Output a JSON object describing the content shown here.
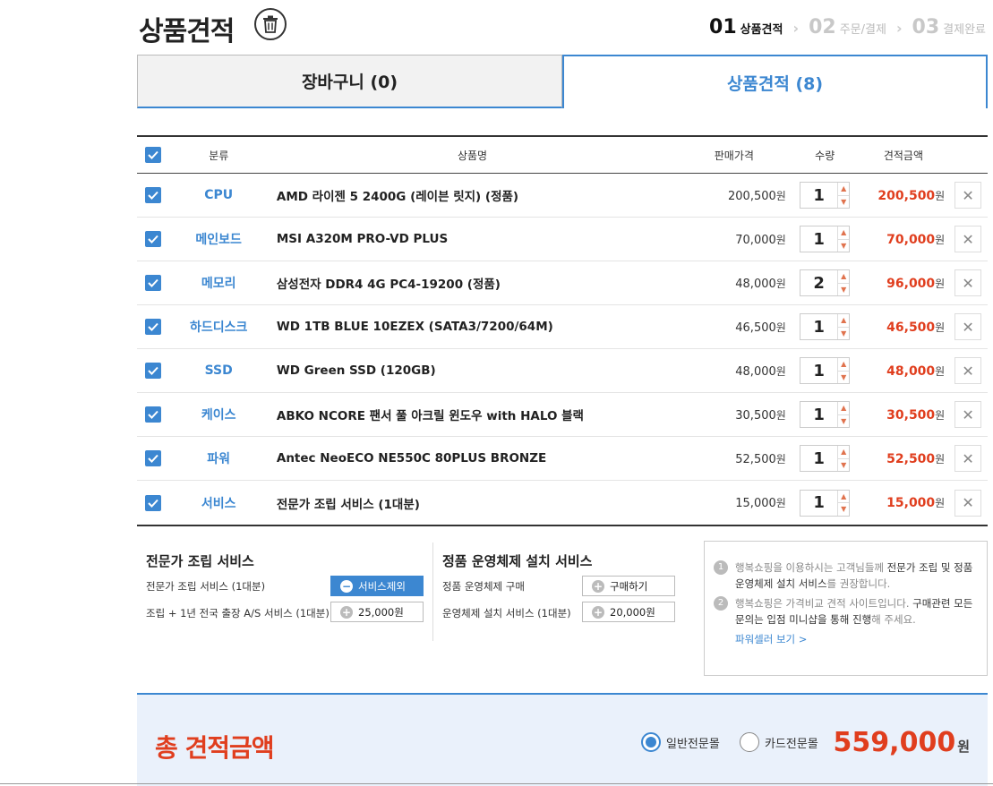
{
  "header": {
    "title": "상품견적",
    "trash_icon": "trash-icon"
  },
  "steps": [
    {
      "num": "01",
      "label": "상품견적",
      "active": true
    },
    {
      "num": "02",
      "label": "주문/결제",
      "active": false
    },
    {
      "num": "03",
      "label": "결제완료",
      "active": false
    }
  ],
  "tabs": {
    "cart": "장바구니 (0)",
    "quote": "상품견적 (8)",
    "active": "quote"
  },
  "table": {
    "headers": {
      "category": "분류",
      "product": "상품명",
      "price": "판매가격",
      "qty": "수량",
      "total": "견적금액"
    },
    "currency": "원",
    "rows": [
      {
        "category": "CPU",
        "name": "AMD 라이젠 5 2400G (레이븐 릿지) (정품)",
        "price": "200,500",
        "qty": "1",
        "total": "200,500",
        "checked": true
      },
      {
        "category": "메인보드",
        "name": "MSI A320M PRO-VD PLUS",
        "price": "70,000",
        "qty": "1",
        "total": "70,000",
        "checked": true
      },
      {
        "category": "메모리",
        "name": "삼성전자 DDR4 4G PC4-19200 (정품)",
        "price": "48,000",
        "qty": "2",
        "total": "96,000",
        "checked": true
      },
      {
        "category": "하드디스크",
        "name": "WD 1TB BLUE 10EZEX (SATA3/7200/64M)",
        "price": "46,500",
        "qty": "1",
        "total": "46,500",
        "checked": true
      },
      {
        "category": "SSD",
        "name": "WD Green SSD (120GB)",
        "price": "48,000",
        "qty": "1",
        "total": "48,000",
        "checked": true
      },
      {
        "category": "케이스",
        "name": "ABKO NCORE 팬서 풀 아크릴 윈도우 with HALO 블랙",
        "price": "30,500",
        "qty": "1",
        "total": "30,500",
        "checked": true
      },
      {
        "category": "파워",
        "name": "Antec NeoECO NE550C 80PLUS BRONZE",
        "price": "52,500",
        "qty": "1",
        "total": "52,500",
        "checked": true
      },
      {
        "category": "서비스",
        "name": "전문가 조립 서비스 (1대분)",
        "price": "15,000",
        "qty": "1",
        "total": "15,000",
        "checked": true
      }
    ]
  },
  "assembly": {
    "title": "전문가 조립 서비스",
    "line1": "전문가 조립 서비스 (1대분)",
    "line1_button": "서비스제외",
    "line2": "조립 + 1년 전국 출장 A/S 서비스 (1대분)",
    "line2_button": "25,000원"
  },
  "os": {
    "title": "정품 운영체제 설치 서비스",
    "line1": "정품 운영체제 구매",
    "line1_button": "구매하기",
    "line2": "운영체제 설치 서비스 (1대분)",
    "line2_button": "20,000원"
  },
  "notice": {
    "item1_a": "행복쇼핑을 이용하시는 고객님들께 ",
    "item1_b": "전문가 조립 및 정품 운영체제 설치 서비스",
    "item1_c": "를 권장합니다.",
    "item2_a": "행복쇼핑은 가격비교 견적 사이트입니다. ",
    "item2_b": "구매관련 모든 문의는 입점 미니샵을 통해 진행",
    "item2_c": "해 주세요.",
    "link": "파워셀러 보기 >"
  },
  "total_bar": {
    "label": "총 견적금액",
    "radio_general": "일반전문몰",
    "radio_card": "카드전문몰",
    "selected": "general",
    "amount": "559,000",
    "currency": "원"
  }
}
